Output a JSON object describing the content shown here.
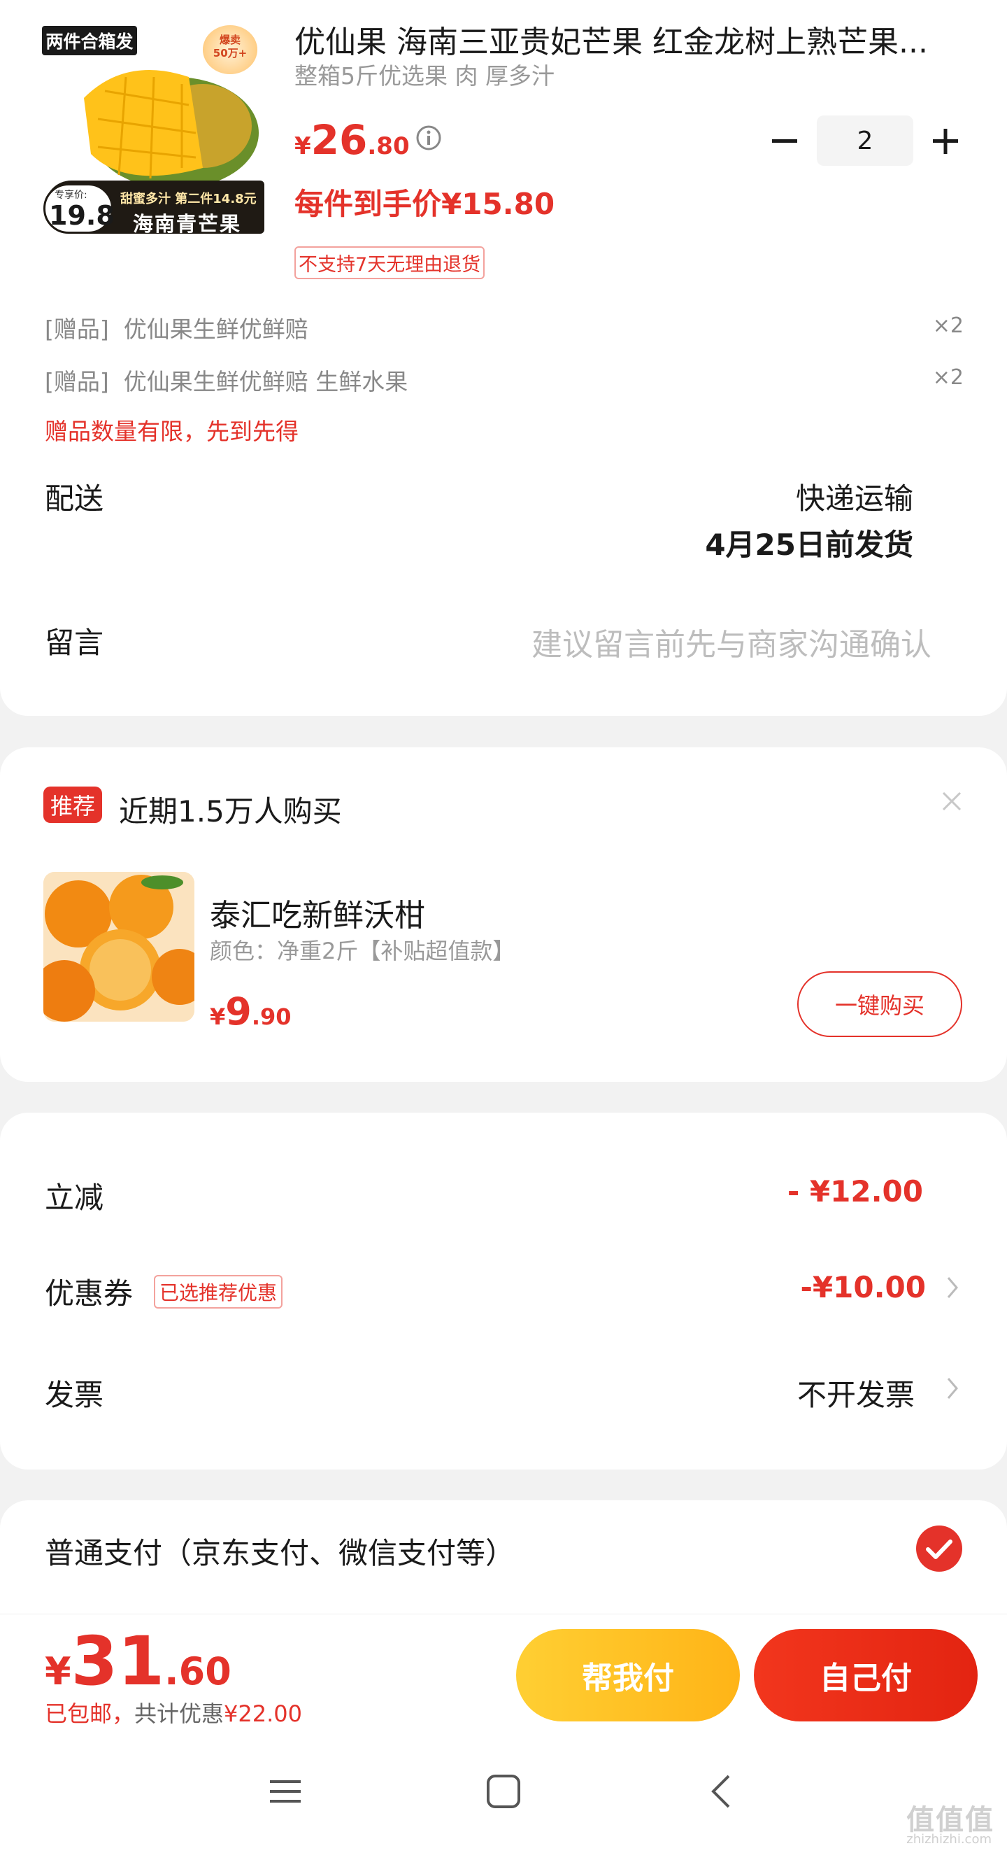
{
  "product": {
    "image": {
      "tag": "两件合箱发",
      "burst_line1": "爆卖",
      "burst_line2": "50万+",
      "price_label": "专享价:",
      "price": "19.8",
      "sub": "甜蜜多汁 第二件14.8元",
      "name": "海南青芒果"
    },
    "title": "优仙果 海南三亚贵妃芒果 红金龙树上熟芒果...",
    "subtitle": "整箱5斤优选果 肉 厚多汁",
    "price": {
      "currency": "¥",
      "integer": "26",
      "decimal": ".80"
    },
    "quantity": "2",
    "final_price": "每件到手价¥15.80",
    "return_policy": "不支持7天无理由退货"
  },
  "gifts": [
    {
      "tag": "[赠品]",
      "name": "优仙果生鲜优鲜赔",
      "qty": "×2"
    },
    {
      "tag": "[赠品]",
      "name": "优仙果生鲜优鲜赔 生鲜水果",
      "qty": "×2"
    }
  ],
  "gift_note": "赠品数量有限，先到先得",
  "delivery": {
    "label": "配送",
    "method": "快递运输",
    "date": "4月25日前发货"
  },
  "message": {
    "label": "留言",
    "placeholder": "建议留言前先与商家沟通确认"
  },
  "recommend": {
    "badge": "推荐",
    "title": "近期1.5万人购买",
    "item": {
      "name": "泰汇吃新鲜沃柑",
      "spec": "颜色：净重2斤【补贴超值款】",
      "price": {
        "currency": "¥",
        "integer": "9",
        "decimal": ".90"
      },
      "buy_label": "一键购买"
    }
  },
  "discounts": {
    "instant": {
      "label": "立减",
      "value": "- ¥12.00"
    },
    "coupon": {
      "label": "优惠券",
      "badge": "已选推荐优惠",
      "value": "-¥10.00"
    },
    "invoice": {
      "label": "发票",
      "value": "不开发票"
    }
  },
  "payment": {
    "label": "普通支付（京东支付、微信支付等）",
    "selected": true
  },
  "footer": {
    "total": {
      "currency": "¥",
      "integer": "31",
      "decimal": ".60"
    },
    "shipping": "已包邮，",
    "saving_label": "共计优惠",
    "saving": "¥22.00",
    "help_pay": "帮我付",
    "self_pay": "自己付"
  },
  "watermark": {
    "main": "值值值",
    "sub": "zhizhizhi.com"
  },
  "colors": {
    "accent": "#e4322a",
    "help_button": "#ffc21f",
    "pay_button": "#e8301a"
  }
}
